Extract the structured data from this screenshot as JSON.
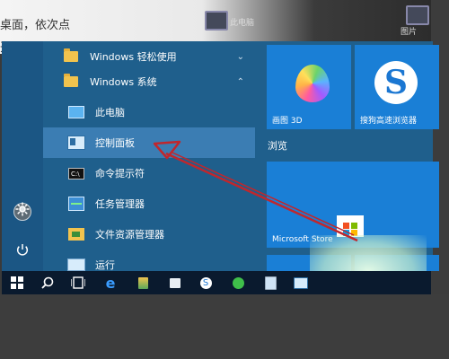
{
  "background": {
    "doc_lines": [
      "桌面，依次点",
      "开"
    ],
    "desktop_icons": [
      {
        "label": "此电脑"
      },
      {
        "label": "图片"
      }
    ]
  },
  "start_menu": {
    "rail": [
      {
        "icon": "user-avatar-icon"
      },
      {
        "icon": "settings-gear-icon"
      },
      {
        "icon": "power-icon"
      }
    ],
    "apps": [
      {
        "label": "Windows 轻松使用",
        "icon": "folder-icon",
        "chevron": "⌄",
        "type": "folder"
      },
      {
        "label": "Windows 系统",
        "icon": "folder-icon",
        "chevron": "⌃",
        "type": "folder"
      },
      {
        "label": "此电脑",
        "icon": "this-pc-icon",
        "type": "app"
      },
      {
        "label": "控制面板",
        "icon": "control-panel-icon",
        "type": "app",
        "selected": true
      },
      {
        "label": "命令提示符",
        "icon": "command-prompt-icon",
        "type": "app"
      },
      {
        "label": "任务管理器",
        "icon": "task-manager-icon",
        "type": "app"
      },
      {
        "label": "文件资源管理器",
        "icon": "file-explorer-icon",
        "type": "app"
      },
      {
        "label": "运行",
        "icon": "run-icon",
        "type": "app"
      }
    ],
    "tiles": {
      "paint3d": "画图 3D",
      "sogou": "搜狗高速浏览器",
      "group_label": "浏览",
      "store": "Microsoft Store"
    }
  },
  "taskbar": {
    "items": [
      "windows-start-icon",
      "search-icon",
      "task-view-icon",
      "edge-icon",
      "pinned-app-icon",
      "store-bag-icon",
      "sogou-browser-icon",
      "green-app-icon",
      "notepad-icon",
      "control-panel-icon"
    ]
  },
  "colors": {
    "start_bg": "#1f5f8c",
    "selected_row": "#3b7db3",
    "tile_blue": "#1a7fd6",
    "taskbar": "#0a1a2e",
    "annotation_arrow": "#c0272d"
  }
}
